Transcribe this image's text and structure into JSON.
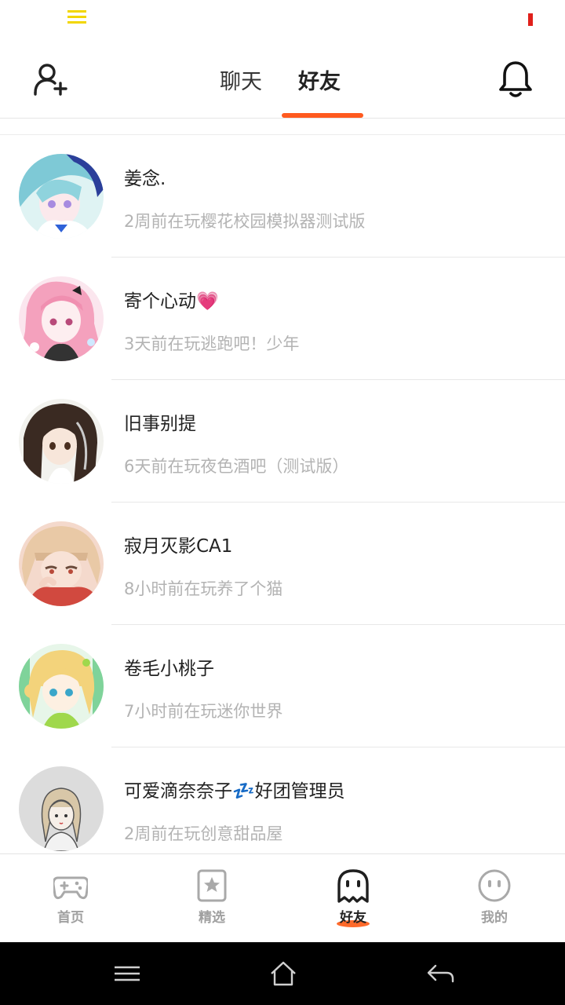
{
  "colors": {
    "accent": "#ff5a1f",
    "status_text": "#b3b3b3",
    "name_text": "#222222"
  },
  "header": {
    "tabs": [
      {
        "label": "聊天"
      },
      {
        "label": "好友"
      }
    ],
    "active_tab": "好友"
  },
  "friends": [
    {
      "name": "姜念.",
      "status": "2周前在玩樱花校园模拟器测试版",
      "avatar": "anime-girl-blue-hair"
    },
    {
      "name": "寄个心动💗",
      "status": "3天前在玩逃跑吧！少年",
      "avatar": "anime-girl-pink-hair"
    },
    {
      "name": "旧事别提",
      "status": "6天前在玩夜色酒吧（测试版）",
      "avatar": "anime-girl-dark-hair"
    },
    {
      "name": "寂月灭影CA1",
      "status": "8小时前在玩养了个猫",
      "avatar": "anime-girl-blonde-bangs"
    },
    {
      "name": "卷毛小桃子",
      "status": "7小时前在玩迷你世界",
      "avatar": "anime-girl-yellow-hair"
    },
    {
      "name": "可爱滴奈奈子💤好团管理员",
      "status": "2周前在玩创意甜品屋",
      "avatar": "sketch-girl-gray"
    }
  ],
  "bottom_nav": {
    "items": [
      {
        "label": "首页",
        "icon": "gamepad-icon"
      },
      {
        "label": "精选",
        "icon": "star-card-icon"
      },
      {
        "label": "好友",
        "icon": "ghost-icon"
      },
      {
        "label": "我的",
        "icon": "smiley-face-icon"
      }
    ],
    "active": "好友"
  },
  "system_nav": {
    "icons": [
      "menu-icon",
      "home-icon",
      "back-icon"
    ]
  }
}
